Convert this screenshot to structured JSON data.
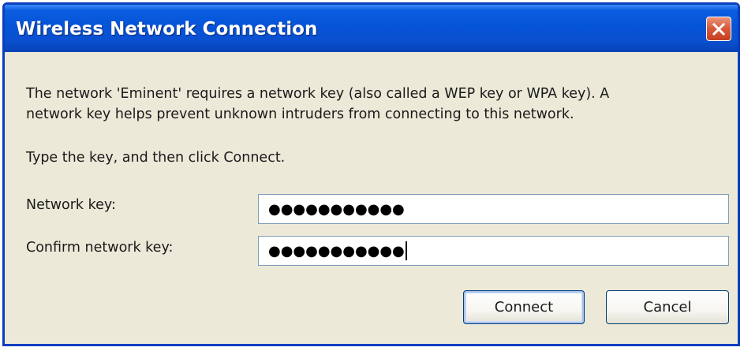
{
  "window": {
    "title": "Wireless Network Connection"
  },
  "message": {
    "line1": "The network 'Eminent' requires a network key (also called a WEP key or WPA key). A",
    "line2": "network key helps prevent unknown intruders from connecting to this network.",
    "instruction": "Type the key, and then click Connect."
  },
  "fields": {
    "network_key": {
      "label": "Network key:",
      "masked_value": "●●●●●●●●●●●"
    },
    "confirm_network_key": {
      "label": "Confirm network key:",
      "masked_value": "●●●●●●●●●●●"
    }
  },
  "buttons": {
    "connect": "Connect",
    "cancel": "Cancel"
  },
  "icons": {
    "close": "close-icon"
  },
  "colors": {
    "titlebar": "#0654d8",
    "close_button": "#d8573a",
    "dialog_background": "#ece9d8",
    "field_border": "#7f9db9",
    "default_button_border": "#003c74"
  }
}
